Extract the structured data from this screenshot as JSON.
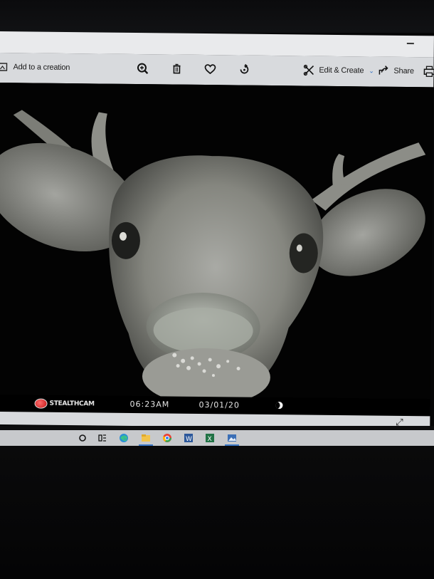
{
  "toolbar": {
    "add_to_creation_label": "Add to a creation",
    "edit_create_label": "Edit & Create",
    "share_label": "Share"
  },
  "photo": {
    "brand": "STEALTHCAM",
    "time": "06:23AM",
    "date": "03/01/20"
  },
  "icons": {
    "toolbar": [
      "image-icon",
      "zoom-in-icon",
      "delete-icon",
      "heart-icon",
      "rotate-icon",
      "edit-create-icon",
      "chevron-down-icon",
      "share-icon",
      "print-icon"
    ],
    "taskbar": [
      "start-circle-icon",
      "task-view-icon",
      "edge-icon",
      "file-explorer-icon",
      "chrome-icon",
      "word-icon",
      "excel-icon",
      "photos-icon"
    ]
  },
  "colors": {
    "toolbar_bg": "#d8dadd",
    "photo_bg": "#030303",
    "accent": "#2b6cc4"
  }
}
